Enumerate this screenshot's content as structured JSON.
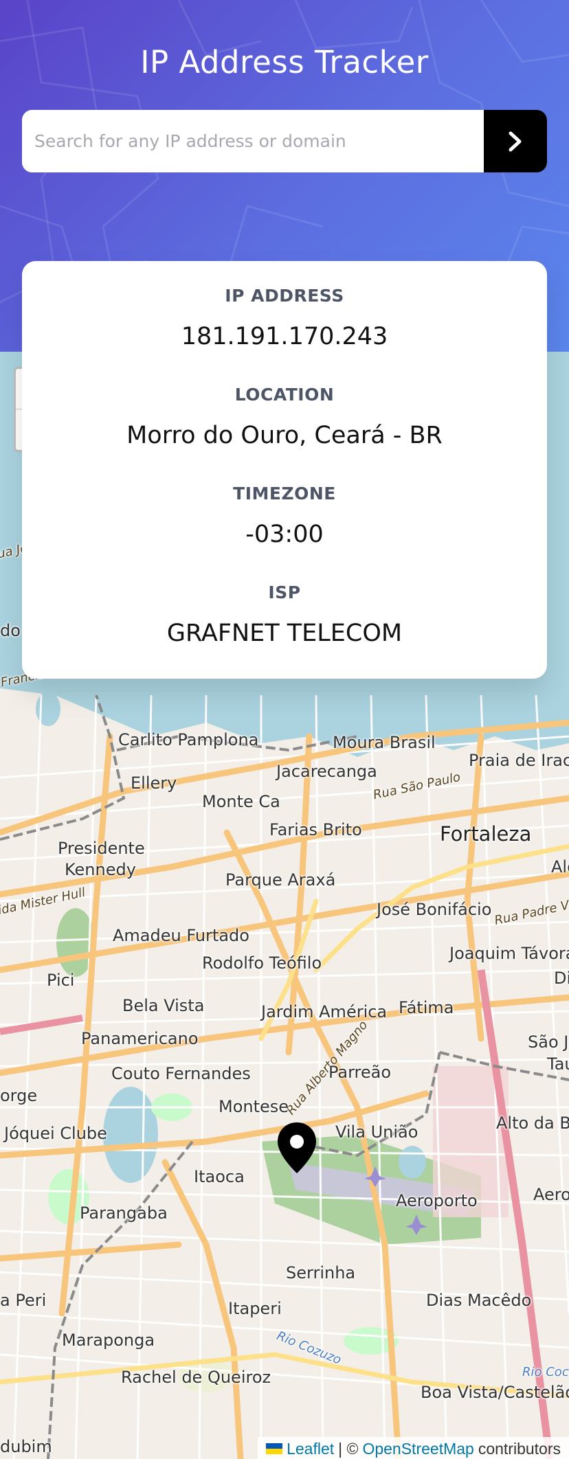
{
  "header": {
    "title": "IP Address Tracker",
    "search_placeholder": "Search for any IP address or domain",
    "search_value": "",
    "submit_icon": "chevron-right-icon"
  },
  "info": {
    "ip_label": "IP ADDRESS",
    "ip_value": "181.191.170.243",
    "location_label": "LOCATION",
    "location_value": "Morro do Ouro, Ceará - BR",
    "timezone_label": "TIMEZONE",
    "timezone_value": "-03:00",
    "isp_label": "ISP",
    "isp_value": "GRAFNET TELECOM"
  },
  "map": {
    "marker_icon": "location-pin-icon",
    "places": {
      "carlito": "Carlito Pamplona",
      "moura": "Moura Brasil",
      "praia": "Praia de Irace",
      "ellery": "Ellery",
      "jacarecanga": "Jacarecanga",
      "rua_sao_paulo": "Rua São Paulo",
      "monte": "Monte Ca",
      "farias": "Farias Brito",
      "fortaleza": "Fortaleza",
      "alo": "Alo",
      "presidente": "Presidente",
      "kennedy": "Kennedy",
      "parque": "Parque Araxá",
      "mister_hull": "ida Mister Hull",
      "jose": "José Bonifácio",
      "padre_valdevino": "Rua Padre Valdevin",
      "amadeu": "Amadeu Furtado",
      "rodolfo": "Rodolfo Teófilo",
      "joaquim": "Joaquim Távora",
      "di": "Di",
      "pici": "Pici",
      "bela_vista": "Bela Vista",
      "jardim": "Jardim América",
      "fatima": "Fátima",
      "sao_jo": "São Jo",
      "tau": "Tau",
      "panamericano": "Panamericano",
      "alberto_magno": "Rua Alberto Magno",
      "couto": "Couto Fernandes",
      "parreao": "Parreão",
      "orge": "orge",
      "montese": "Montese",
      "alto_da_ba": "Alto da Ba",
      "joquei": "Jóquei Clube",
      "vila_uniao": "Vila União",
      "itaoca": "Itaoca",
      "aeroporto": "Aeroporto",
      "aerolan": "Aerolân",
      "parangaba": "Parangaba",
      "serrinha": "Serrinha",
      "dias_macedo": "Dias Macêdo",
      "a_peri": "a Peri",
      "itaperi": "Itaperi",
      "rio_cocozinho": "Rio Cozuzo",
      "maraponga": "Maraponga",
      "rio_coco": "Rio Cocó",
      "rachel": "Rachel de Queiroz",
      "boa_vista": "Boa Vista/Castelão",
      "dubim": "dubim",
      "francisco_sa": "Francisco Sá",
      "do": "do",
      "ua_jo": "ua Jo"
    },
    "attribution": {
      "leaflet": "Leaflet",
      "separator": "| ©",
      "osm": "OpenStreetMap",
      "contributors": "contributors"
    }
  }
}
